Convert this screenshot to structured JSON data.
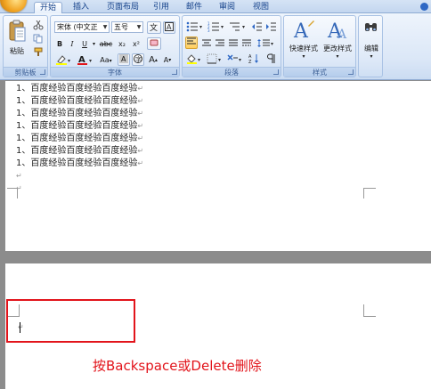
{
  "tabs": [
    {
      "label": "开始",
      "active": true
    },
    {
      "label": "插入"
    },
    {
      "label": "页面布局"
    },
    {
      "label": "引用"
    },
    {
      "label": "邮件"
    },
    {
      "label": "审阅"
    },
    {
      "label": "视图"
    }
  ],
  "clipboard": {
    "paste_label": "粘贴",
    "group_label": "剪贴板"
  },
  "font": {
    "font_name": "宋体 (中文正",
    "font_size": "五号",
    "bold": "B",
    "italic": "I",
    "underline": "U",
    "strike": "abc",
    "subscript": "x₂",
    "superscript": "x²",
    "case": "Aa",
    "grow": "A",
    "shrink": "A",
    "group_label": "字体"
  },
  "paragraph": {
    "group_label": "段落"
  },
  "styles": {
    "quick_styles": "快速样式",
    "change_styles": "更改样式",
    "group_label": "样式"
  },
  "editing": {
    "label": "编辑"
  },
  "document": {
    "lines": [
      "1、百度经验百度经验百度经验",
      "1、百度经验百度经验百度经验",
      "1、百度经验百度经验百度经验",
      "1、百度经验百度经验百度经验",
      "1、百度经验百度经验百度经验",
      "1、百度经验百度经验百度经验",
      "1、百度经验百度经验百度经验"
    ]
  },
  "annotation": {
    "caption": "按Backspace或Delete删除",
    "color": "#e2141b"
  },
  "colors": {
    "ribbon_bg": "#dbe7f7",
    "tab_text": "#15428b"
  }
}
